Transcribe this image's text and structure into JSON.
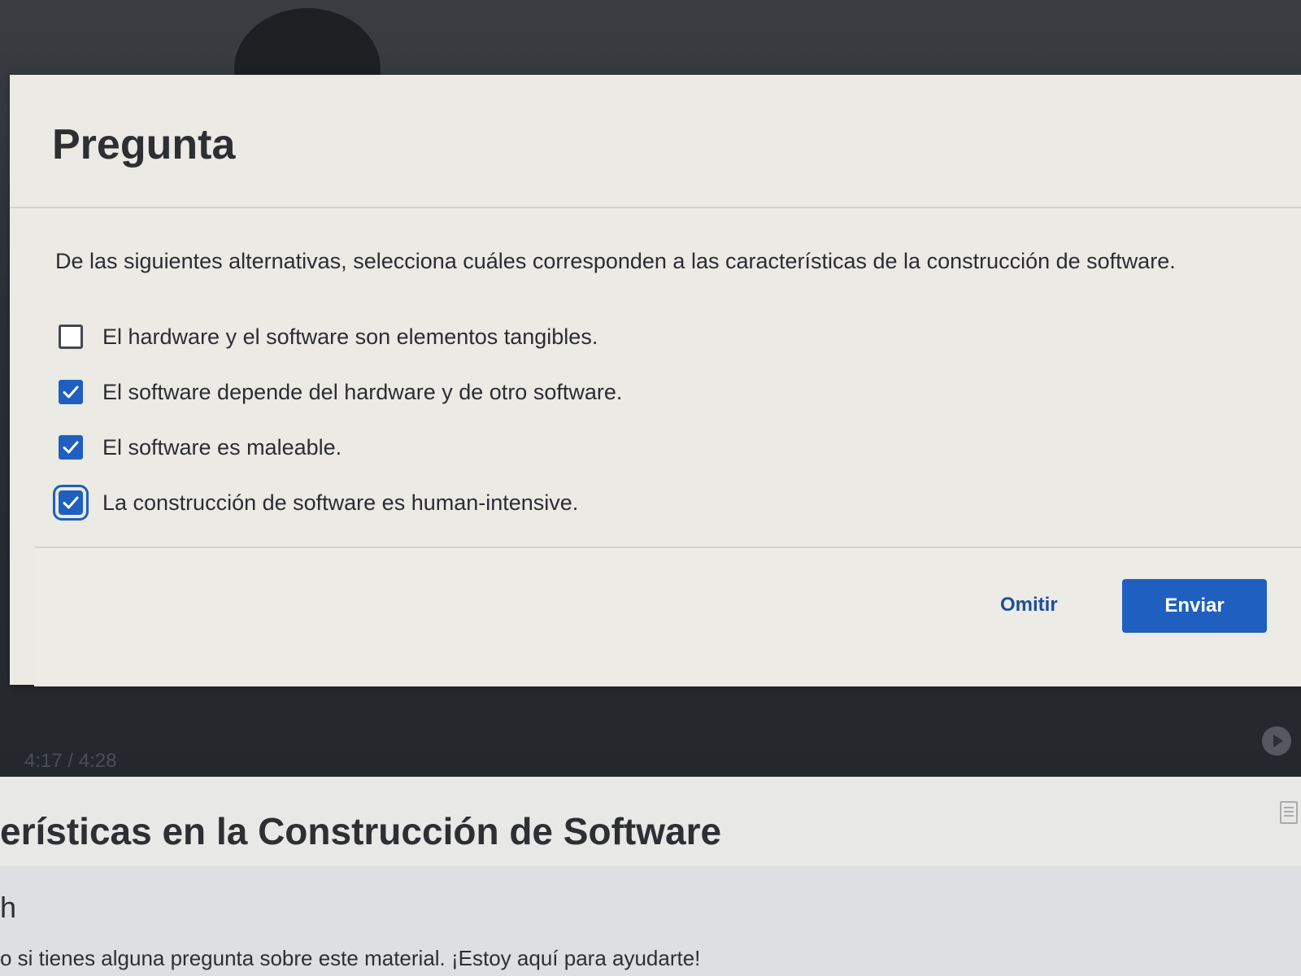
{
  "video": {
    "time_readout": "4:17 / 4:28"
  },
  "modal": {
    "title": "Pregunta",
    "question": "De las siguientes alternativas, selecciona cuáles corresponden a las características de la construcción de software.",
    "options": [
      {
        "label": "El hardware y el software son elementos tangibles.",
        "checked": false
      },
      {
        "label": "El software depende del hardware y de otro software.",
        "checked": true
      },
      {
        "label": "El software es maleable.",
        "checked": true
      },
      {
        "label": "La construcción de software es human-intensive.",
        "checked": true,
        "focused": true
      }
    ],
    "skip_label": "Omitir",
    "submit_label": "Enviar",
    "accent_color": "#1f5fbf"
  },
  "page": {
    "subtitle": "erísticas en la Construcción de Software",
    "partial_heading": "h",
    "assist_text": "o si tienes alguna pregunta sobre este material. ¡Estoy aquí para ayudarte!"
  }
}
